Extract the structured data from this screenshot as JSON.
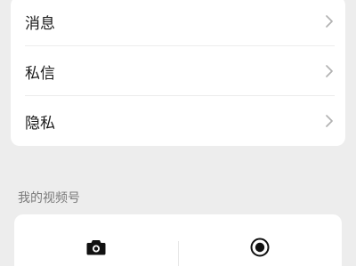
{
  "settings": {
    "items": [
      {
        "label": "消息",
        "icon": "chevron-right-icon"
      },
      {
        "label": "私信",
        "icon": "chevron-right-icon"
      },
      {
        "label": "隐私",
        "icon": "chevron-right-icon"
      }
    ]
  },
  "channel_section": {
    "title": "我的视频号",
    "actions": [
      {
        "icon": "camera-icon"
      },
      {
        "icon": "record-icon"
      }
    ]
  },
  "colors": {
    "background": "#ededed",
    "card": "#ffffff",
    "text": "#1a1a1a",
    "secondary_text": "#7a7a7a",
    "chevron": "#b2b2b2"
  }
}
